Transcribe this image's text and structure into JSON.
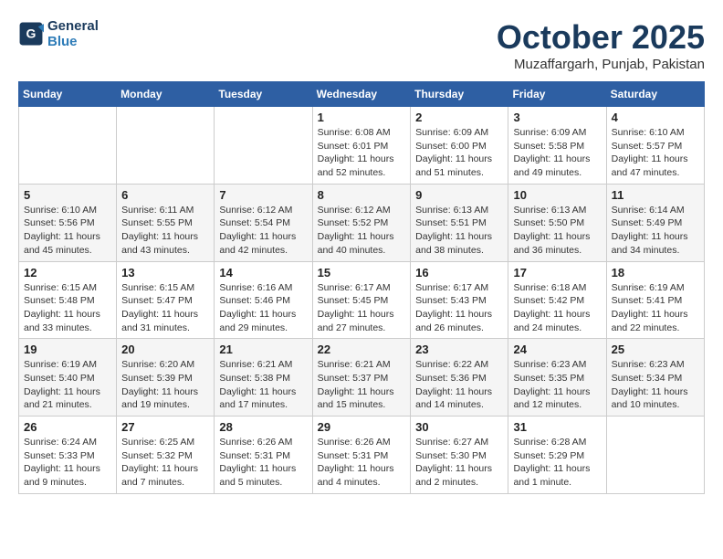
{
  "logo": {
    "line1": "General",
    "line2": "Blue"
  },
  "title": "October 2025",
  "subtitle": "Muzaffargarh, Punjab, Pakistan",
  "weekdays": [
    "Sunday",
    "Monday",
    "Tuesday",
    "Wednesday",
    "Thursday",
    "Friday",
    "Saturday"
  ],
  "weeks": [
    [
      {
        "day": "",
        "info": ""
      },
      {
        "day": "",
        "info": ""
      },
      {
        "day": "",
        "info": ""
      },
      {
        "day": "1",
        "info": "Sunrise: 6:08 AM\nSunset: 6:01 PM\nDaylight: 11 hours\nand 52 minutes."
      },
      {
        "day": "2",
        "info": "Sunrise: 6:09 AM\nSunset: 6:00 PM\nDaylight: 11 hours\nand 51 minutes."
      },
      {
        "day": "3",
        "info": "Sunrise: 6:09 AM\nSunset: 5:58 PM\nDaylight: 11 hours\nand 49 minutes."
      },
      {
        "day": "4",
        "info": "Sunrise: 6:10 AM\nSunset: 5:57 PM\nDaylight: 11 hours\nand 47 minutes."
      }
    ],
    [
      {
        "day": "5",
        "info": "Sunrise: 6:10 AM\nSunset: 5:56 PM\nDaylight: 11 hours\nand 45 minutes."
      },
      {
        "day": "6",
        "info": "Sunrise: 6:11 AM\nSunset: 5:55 PM\nDaylight: 11 hours\nand 43 minutes."
      },
      {
        "day": "7",
        "info": "Sunrise: 6:12 AM\nSunset: 5:54 PM\nDaylight: 11 hours\nand 42 minutes."
      },
      {
        "day": "8",
        "info": "Sunrise: 6:12 AM\nSunset: 5:52 PM\nDaylight: 11 hours\nand 40 minutes."
      },
      {
        "day": "9",
        "info": "Sunrise: 6:13 AM\nSunset: 5:51 PM\nDaylight: 11 hours\nand 38 minutes."
      },
      {
        "day": "10",
        "info": "Sunrise: 6:13 AM\nSunset: 5:50 PM\nDaylight: 11 hours\nand 36 minutes."
      },
      {
        "day": "11",
        "info": "Sunrise: 6:14 AM\nSunset: 5:49 PM\nDaylight: 11 hours\nand 34 minutes."
      }
    ],
    [
      {
        "day": "12",
        "info": "Sunrise: 6:15 AM\nSunset: 5:48 PM\nDaylight: 11 hours\nand 33 minutes."
      },
      {
        "day": "13",
        "info": "Sunrise: 6:15 AM\nSunset: 5:47 PM\nDaylight: 11 hours\nand 31 minutes."
      },
      {
        "day": "14",
        "info": "Sunrise: 6:16 AM\nSunset: 5:46 PM\nDaylight: 11 hours\nand 29 minutes."
      },
      {
        "day": "15",
        "info": "Sunrise: 6:17 AM\nSunset: 5:45 PM\nDaylight: 11 hours\nand 27 minutes."
      },
      {
        "day": "16",
        "info": "Sunrise: 6:17 AM\nSunset: 5:43 PM\nDaylight: 11 hours\nand 26 minutes."
      },
      {
        "day": "17",
        "info": "Sunrise: 6:18 AM\nSunset: 5:42 PM\nDaylight: 11 hours\nand 24 minutes."
      },
      {
        "day": "18",
        "info": "Sunrise: 6:19 AM\nSunset: 5:41 PM\nDaylight: 11 hours\nand 22 minutes."
      }
    ],
    [
      {
        "day": "19",
        "info": "Sunrise: 6:19 AM\nSunset: 5:40 PM\nDaylight: 11 hours\nand 21 minutes."
      },
      {
        "day": "20",
        "info": "Sunrise: 6:20 AM\nSunset: 5:39 PM\nDaylight: 11 hours\nand 19 minutes."
      },
      {
        "day": "21",
        "info": "Sunrise: 6:21 AM\nSunset: 5:38 PM\nDaylight: 11 hours\nand 17 minutes."
      },
      {
        "day": "22",
        "info": "Sunrise: 6:21 AM\nSunset: 5:37 PM\nDaylight: 11 hours\nand 15 minutes."
      },
      {
        "day": "23",
        "info": "Sunrise: 6:22 AM\nSunset: 5:36 PM\nDaylight: 11 hours\nand 14 minutes."
      },
      {
        "day": "24",
        "info": "Sunrise: 6:23 AM\nSunset: 5:35 PM\nDaylight: 11 hours\nand 12 minutes."
      },
      {
        "day": "25",
        "info": "Sunrise: 6:23 AM\nSunset: 5:34 PM\nDaylight: 11 hours\nand 10 minutes."
      }
    ],
    [
      {
        "day": "26",
        "info": "Sunrise: 6:24 AM\nSunset: 5:33 PM\nDaylight: 11 hours\nand 9 minutes."
      },
      {
        "day": "27",
        "info": "Sunrise: 6:25 AM\nSunset: 5:32 PM\nDaylight: 11 hours\nand 7 minutes."
      },
      {
        "day": "28",
        "info": "Sunrise: 6:26 AM\nSunset: 5:31 PM\nDaylight: 11 hours\nand 5 minutes."
      },
      {
        "day": "29",
        "info": "Sunrise: 6:26 AM\nSunset: 5:31 PM\nDaylight: 11 hours\nand 4 minutes."
      },
      {
        "day": "30",
        "info": "Sunrise: 6:27 AM\nSunset: 5:30 PM\nDaylight: 11 hours\nand 2 minutes."
      },
      {
        "day": "31",
        "info": "Sunrise: 6:28 AM\nSunset: 5:29 PM\nDaylight: 11 hours\nand 1 minute."
      },
      {
        "day": "",
        "info": ""
      }
    ]
  ]
}
